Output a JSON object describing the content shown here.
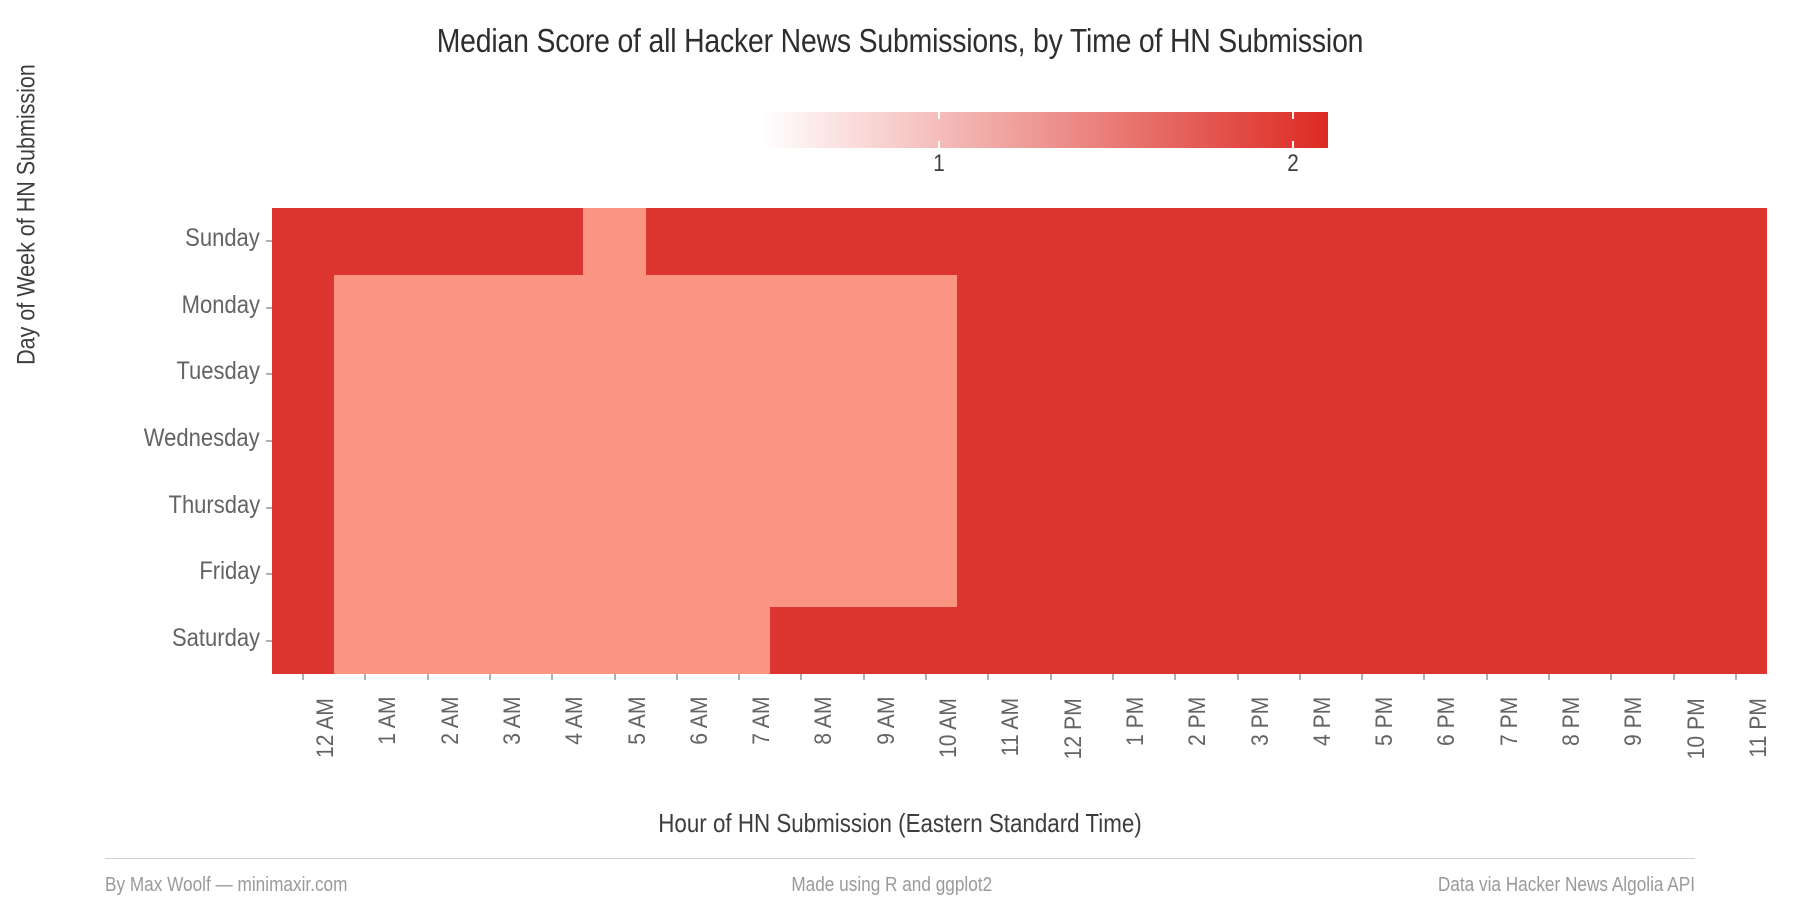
{
  "chart_data": {
    "type": "heatmap",
    "title": "Median Score of all Hacker News Submissions, by Time of HN Submission",
    "xlabel": "Hour of HN Submission (Eastern Standard Time)",
    "ylabel": "Day of Week of HN Submission",
    "x_categories": [
      "12 AM",
      "1 AM",
      "2 AM",
      "3 AM",
      "4 AM",
      "5 AM",
      "6 AM",
      "7 AM",
      "8 AM",
      "9 AM",
      "10 AM",
      "11 AM",
      "12 PM",
      "1 PM",
      "2 PM",
      "3 PM",
      "4 PM",
      "5 PM",
      "6 PM",
      "7 PM",
      "8 PM",
      "9 PM",
      "10 PM",
      "11 PM"
    ],
    "y_categories": [
      "Sunday",
      "Monday",
      "Tuesday",
      "Wednesday",
      "Thursday",
      "Friday",
      "Saturday"
    ],
    "legend": {
      "ticks": [
        "1",
        "2"
      ],
      "tick_values": [
        1,
        2
      ],
      "range": [
        0.5,
        2.1
      ],
      "low_color": "#FFFFFF",
      "high_color": "#DC2A22",
      "position": "top"
    },
    "grid": false,
    "values": [
      [
        2,
        2,
        2,
        2,
        2,
        1,
        2,
        2,
        2,
        2,
        2,
        2,
        2,
        2,
        2,
        2,
        2,
        2,
        2,
        2,
        2,
        2,
        2,
        2
      ],
      [
        2,
        1,
        1,
        1,
        1,
        1,
        1,
        1,
        1,
        1,
        1,
        2,
        2,
        2,
        2,
        2,
        2,
        2,
        2,
        2,
        2,
        2,
        2,
        2
      ],
      [
        2,
        1,
        1,
        1,
        1,
        1,
        1,
        1,
        1,
        1,
        1,
        2,
        2,
        2,
        2,
        2,
        2,
        2,
        2,
        2,
        2,
        2,
        2,
        2
      ],
      [
        2,
        1,
        1,
        1,
        1,
        1,
        1,
        1,
        1,
        1,
        1,
        2,
        2,
        2,
        2,
        2,
        2,
        2,
        2,
        2,
        2,
        2,
        2,
        2
      ],
      [
        2,
        1,
        1,
        1,
        1,
        1,
        1,
        1,
        1,
        1,
        1,
        2,
        2,
        2,
        2,
        2,
        2,
        2,
        2,
        2,
        2,
        2,
        2,
        2
      ],
      [
        2,
        1,
        1,
        1,
        1,
        1,
        1,
        1,
        1,
        1,
        1,
        2,
        2,
        2,
        2,
        2,
        2,
        2,
        2,
        2,
        2,
        2,
        2,
        2
      ],
      [
        2,
        1,
        1,
        1,
        1,
        1,
        1,
        1,
        2,
        2,
        2,
        2,
        2,
        2,
        2,
        2,
        2,
        2,
        2,
        2,
        2,
        2,
        2,
        2
      ]
    ],
    "value_colors": {
      "1": "#FA9584",
      "2": "#DC342F"
    }
  },
  "footer": {
    "left": "By Max Woolf — minimaxir.com",
    "center": "Made using R and ggplot2",
    "right": "Data via Hacker News Algolia API"
  }
}
